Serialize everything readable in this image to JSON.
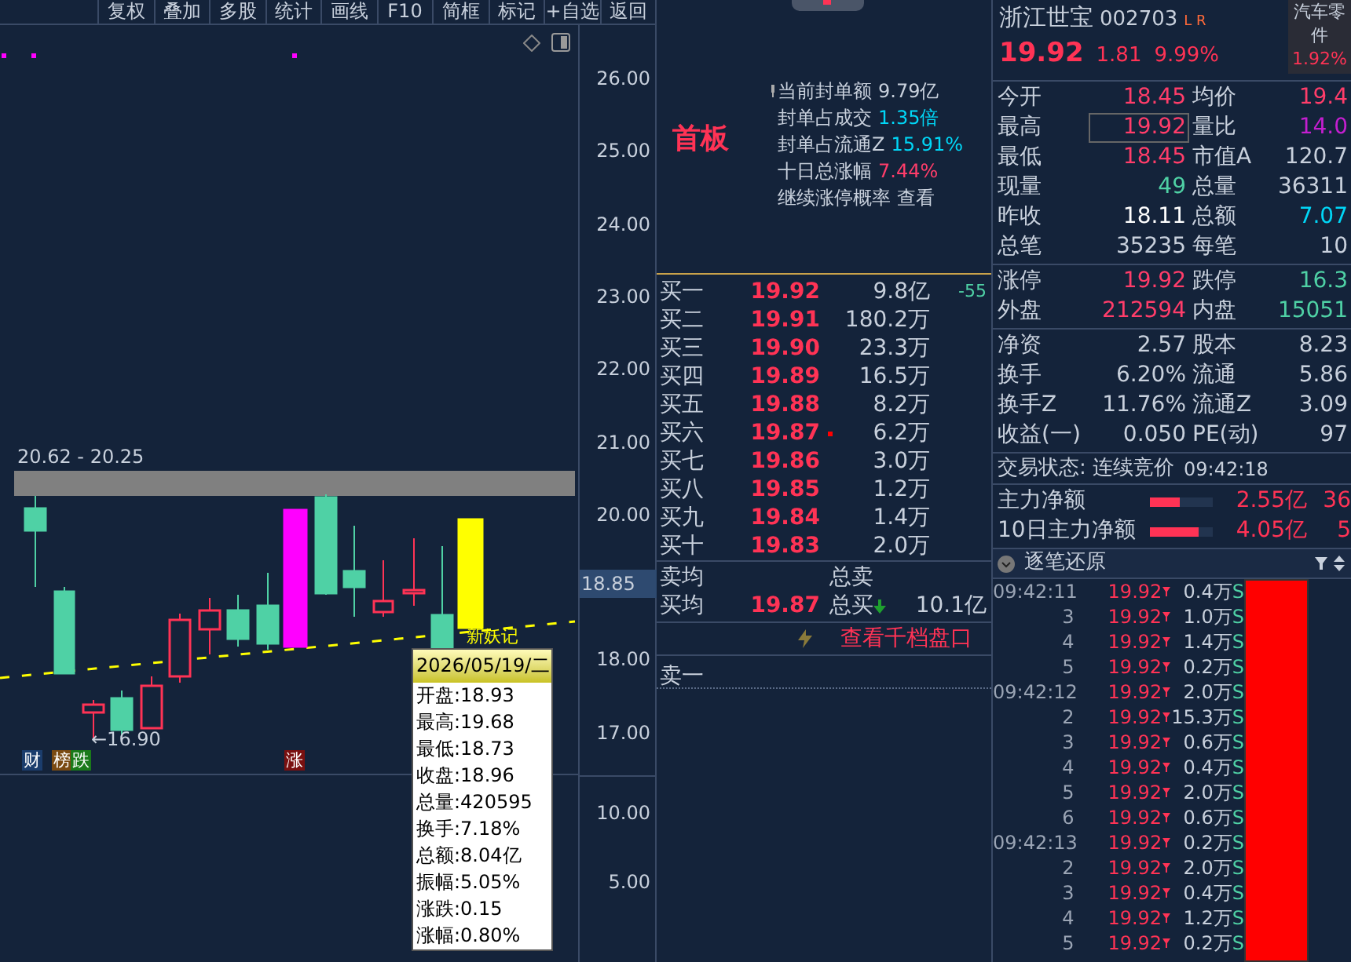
{
  "toolbar": [
    "复权",
    "叠加",
    "多股",
    "统计",
    "画线",
    "F10",
    "简框",
    "标记",
    "+自选",
    "返回"
  ],
  "chart": {
    "range_label": "20.62 - 20.25",
    "low_label": "←16.90",
    "pattern_label": "新妖记",
    "markers": [
      {
        "text": "财",
        "color": "#1b3d6d"
      },
      {
        "text": "榜",
        "color": "#7a4a12"
      },
      {
        "text": "跌",
        "color": "#1a7a1a"
      },
      {
        "text": "涨",
        "color": "#7a1010"
      }
    ],
    "price_axis": [
      "26.00",
      "25.00",
      "24.00",
      "23.00",
      "22.00",
      "21.00",
      "20.00",
      "18.00",
      "17.00"
    ],
    "current_price": "18.85",
    "volume_axis": [
      "10.00",
      "5.00"
    ],
    "tooltip": {
      "date": "2026/05/19/二",
      "rows": [
        "开盘:18.93",
        "最高:19.68",
        "最低:18.73",
        "收盘:18.96",
        "总量:420595",
        "换手:7.18%",
        "总额:8.04亿",
        "振幅:5.05%",
        "涨跌:0.15",
        "涨幅:0.80%"
      ]
    }
  },
  "seal": {
    "badge": "首板",
    "lines": [
      {
        "label": "当前封单额",
        "value": "9.79亿",
        "color": "#c8d0dc"
      },
      {
        "label": "封单占成交",
        "value": "1.35倍",
        "color": "#00d7f7"
      },
      {
        "label": "封单占流通Z",
        "value": "15.91%",
        "color": "#00d7f7"
      },
      {
        "label": "十日总涨幅",
        "value": "7.44%",
        "color": "#ff3d6a"
      },
      {
        "label": "继续涨停概率",
        "value": "查看",
        "color": "#c8d0dc"
      }
    ]
  },
  "order_book": [
    {
      "label": "买一",
      "price": "19.92",
      "volume": "9.8亿",
      "change": "-55",
      "flagged": false
    },
    {
      "label": "买二",
      "price": "19.91",
      "volume": "180.2万",
      "flagged": false
    },
    {
      "label": "买三",
      "price": "19.90",
      "volume": "23.3万",
      "flagged": false
    },
    {
      "label": "买四",
      "price": "19.89",
      "volume": "16.5万",
      "flagged": false
    },
    {
      "label": "买五",
      "price": "19.88",
      "volume": "8.2万",
      "flagged": false
    },
    {
      "label": "买六",
      "price": "19.87",
      "volume": "6.2万",
      "flagged": true
    },
    {
      "label": "买七",
      "price": "19.86",
      "volume": "3.0万",
      "flagged": false
    },
    {
      "label": "买八",
      "price": "19.85",
      "volume": "1.2万",
      "flagged": false
    },
    {
      "label": "买九",
      "price": "19.84",
      "volume": "1.4万",
      "flagged": false
    },
    {
      "label": "买十",
      "price": "19.83",
      "volume": "2.0万",
      "flagged": false
    }
  ],
  "averages": {
    "sell_label": "卖均",
    "sell_total_label": "总卖",
    "buy_label": "买均",
    "buy_price": "19.87",
    "buy_total_label": "总买",
    "buy_total": "10.1亿"
  },
  "depth_link": "查看千档盘口",
  "sell_one": "卖一",
  "quote": {
    "name": "浙江世宝",
    "code": "002703",
    "flags": "L R",
    "price": "19.92",
    "change": "1.81",
    "percent": "9.99%",
    "sector_lines": [
      "汽车零",
      "件"
    ],
    "sector_change": "1.92%"
  },
  "stats": [
    [
      [
        {
          "label": "今开",
          "value": "18.45",
          "color": "#ff3d6a",
          "boxed": false
        },
        {
          "label": "均价",
          "value": "19.4",
          "color": "#ff3d6a",
          "boxed": false
        }
      ],
      [
        {
          "label": "最高",
          "value": "19.92",
          "color": "#ff3d6a",
          "boxed": true
        },
        {
          "label": "量比",
          "value": "14.0",
          "color": "#c41fd0",
          "boxed": false
        }
      ],
      [
        {
          "label": "最低",
          "value": "18.45",
          "color": "#ff3d6a",
          "boxed": false
        },
        {
          "label": "市值A",
          "value": "120.7",
          "color": "#c8d0dc",
          "boxed": false
        }
      ],
      [
        {
          "label": "现量",
          "value": "49",
          "color": "#4fd1a5",
          "boxed": false
        },
        {
          "label": "总量",
          "value": "36311",
          "color": "#c8d0dc",
          "boxed": false
        }
      ],
      [
        {
          "label": "昨收",
          "value": "18.11",
          "color": "#ffffff",
          "boxed": false
        },
        {
          "label": "总额",
          "value": "7.07",
          "color": "#00d7f7",
          "boxed": false
        }
      ],
      [
        {
          "label": "总笔",
          "value": "35235",
          "color": "#c8d0dc",
          "boxed": false
        },
        {
          "label": "每笔",
          "value": "10",
          "color": "#c8d0dc",
          "boxed": false
        }
      ]
    ],
    [
      [
        {
          "label": "涨停",
          "value": "19.92",
          "color": "#ff3d6a",
          "boxed": false
        },
        {
          "label": "跌停",
          "value": "16.3",
          "color": "#4fd1a5",
          "boxed": false
        }
      ],
      [
        {
          "label": "外盘",
          "value": "212594",
          "color": "#ff3d6a",
          "boxed": false
        },
        {
          "label": "内盘",
          "value": "15051",
          "color": "#4fd1a5",
          "boxed": false
        }
      ]
    ],
    [
      [
        {
          "label": "净资",
          "value": "2.57",
          "color": "#c8d0dc",
          "boxed": false
        },
        {
          "label": "股本",
          "value": "8.23",
          "color": "#c8d0dc",
          "boxed": false
        }
      ],
      [
        {
          "label": "换手",
          "value": "6.20%",
          "color": "#c8d0dc",
          "boxed": false
        },
        {
          "label": "流通",
          "value": "5.86",
          "color": "#c8d0dc",
          "boxed": false
        }
      ],
      [
        {
          "label": "换手Z",
          "value": "11.76%",
          "color": "#c8d0dc",
          "boxed": false
        },
        {
          "label": "流通Z",
          "value": "3.09",
          "color": "#c8d0dc",
          "boxed": false
        }
      ],
      [
        {
          "label": "收益(一)",
          "value": "0.050",
          "color": "#c8d0dc",
          "boxed": false
        },
        {
          "label": "PE(动)",
          "value": "97",
          "color": "#c8d0dc",
          "boxed": false
        }
      ]
    ]
  ],
  "status": {
    "label": "交易状态: 连续竞价",
    "time": "09:42:18"
  },
  "fund_flow": [
    {
      "label": "主力净额",
      "level": 0.47,
      "value": "2.55亿",
      "value_2": "36"
    },
    {
      "label": "10日主力净额",
      "level": 0.78,
      "value": "4.05亿",
      "value_2": "5"
    }
  ],
  "ticks_title": "逐笔还原",
  "ticks": [
    {
      "time": "09:42:11",
      "price": "19.92",
      "volume": "0.4万",
      "side": "S"
    },
    {
      "time": "3",
      "price": "19.92",
      "volume": "1.0万",
      "side": "S"
    },
    {
      "time": "4",
      "price": "19.92",
      "volume": "1.4万",
      "side": "S"
    },
    {
      "time": "5",
      "price": "19.92",
      "volume": "0.2万",
      "side": "S"
    },
    {
      "time": "09:42:12",
      "price": "19.92",
      "volume": "2.0万",
      "side": "S"
    },
    {
      "time": "2",
      "price": "19.92",
      "volume": "15.3万",
      "side": "S"
    },
    {
      "time": "3",
      "price": "19.92",
      "volume": "0.6万",
      "side": "S"
    },
    {
      "time": "4",
      "price": "19.92",
      "volume": "0.4万",
      "side": "S"
    },
    {
      "time": "5",
      "price": "19.92",
      "volume": "2.0万",
      "side": "S"
    },
    {
      "time": "6",
      "price": "19.92",
      "volume": "0.6万",
      "side": "S"
    },
    {
      "time": "09:42:13",
      "price": "19.92",
      "volume": "0.2万",
      "side": "S"
    },
    {
      "time": "2",
      "price": "19.92",
      "volume": "2.0万",
      "side": "S"
    },
    {
      "time": "3",
      "price": "19.92",
      "volume": "0.4万",
      "side": "S"
    },
    {
      "time": "4",
      "price": "19.92",
      "volume": "1.2万",
      "side": "S"
    },
    {
      "time": "5",
      "price": "19.92",
      "volume": "0.2万",
      "side": "S"
    }
  ]
}
